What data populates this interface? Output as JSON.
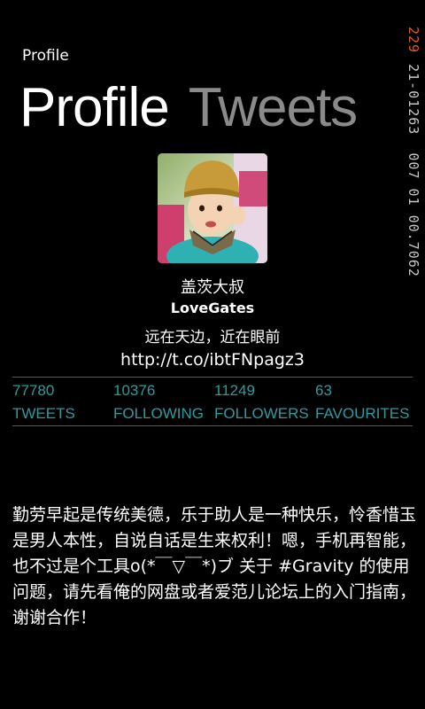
{
  "app": {
    "label": "Profile"
  },
  "pivot": {
    "active": "Profile",
    "inactive": "Tweets"
  },
  "status_bar": {
    "battery": "229",
    "date": "21-01263",
    "time": "007 01 00.7062"
  },
  "profile": {
    "display_name": "盖茨大叔",
    "screen_name": "LoveGates",
    "bio": "远在天边，近在眼前",
    "url": "http://t.co/ibtFNpagz3"
  },
  "stats": [
    {
      "count": "77780",
      "label": "TWEETS"
    },
    {
      "count": "10376",
      "label": "FOLLOWING"
    },
    {
      "count": "11249",
      "label": "FOLLOWERS"
    },
    {
      "count": "63",
      "label": "FAVOURITES"
    }
  ],
  "latest_tweet": {
    "text": "勤劳早起是传统美德，乐于助人是一种快乐，怜香惜玉是男人本性，自说自话是生来权利！嗯，手机再智能，也不过是个工具o(*￣▽￣*)ブ 关于 #Gravity 的使用问题，请先看俺的网盘或者爱范儿论坛上的入门指南，谢谢合作！"
  },
  "colors": {
    "background": "#000000",
    "accent": "#2e9ba0",
    "inactive_pivot": "#8a8a8a",
    "battery": "#e05a1e"
  }
}
